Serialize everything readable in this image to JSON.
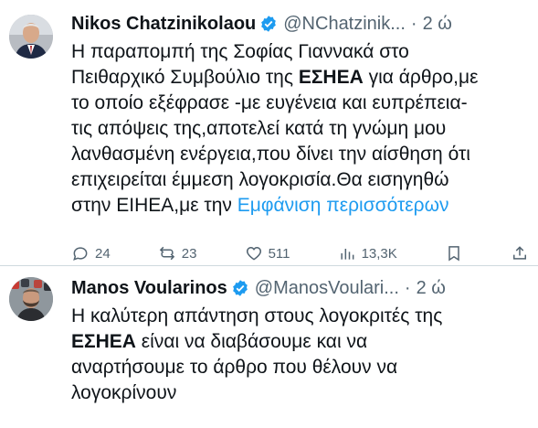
{
  "tweets": [
    {
      "author_name": "Nikos Chatzinikolaou",
      "handle": "@NChatzinik...",
      "separator": "·",
      "time": "2 ώ",
      "lines": [
        [
          {
            "t": "Η παραπομπή της Σοφίας Γιαννακά στο"
          }
        ],
        [
          {
            "t": "Πειθαρχικό Συμβούλιο της "
          },
          {
            "t": "ΕΣΗΕΑ",
            "b": true
          },
          {
            "t": " για άρθρο,με"
          }
        ],
        [
          {
            "t": "το οποίο εξέφρασε -με ευγένεια και ευπρέπεια-"
          }
        ],
        [
          {
            "t": "τις απόψεις της,αποτελεί κατά τη γνώμη μου"
          }
        ],
        [
          {
            "t": "λανθασμένη ενέργεια,που δίνει την αίσθηση ότι"
          }
        ],
        [
          {
            "t": "επιχειρείται έμμεση λογοκρισία.Θα εισηγηθώ"
          }
        ],
        [
          {
            "t": "στην ΕΙΗΕΑ,με την "
          },
          {
            "t": "Εμφάνιση περισσότερων",
            "link": true
          }
        ]
      ],
      "actions": [
        {
          "icon": "reply-icon",
          "count": "24"
        },
        {
          "icon": "retweet-icon",
          "count": "23"
        },
        {
          "icon": "like-icon",
          "count": "511"
        },
        {
          "icon": "views-icon",
          "count": "13,3K"
        },
        {
          "icon": "bookmark-icon",
          "count": ""
        },
        {
          "icon": "share-icon",
          "count": ""
        }
      ]
    },
    {
      "author_name": "Manos Voularinos",
      "handle": "@ManosVoulari...",
      "separator": "·",
      "time": "2 ώ",
      "lines": [
        [
          {
            "t": "Η καλύτερη απάντηση στους λογοκριτές της"
          }
        ],
        [
          {
            "t": "ΕΣΗΕΑ",
            "b": true
          },
          {
            "t": " είναι να διαβάσουμε και να"
          }
        ],
        [
          {
            "t": "αναρτήσουμε το άρθρο που θέλουν να"
          }
        ],
        [
          {
            "t": "λογοκρίνουν"
          }
        ]
      ]
    }
  ],
  "colors": {
    "text": "#0f1419",
    "secondary": "#536471",
    "link": "#1d9bf0",
    "verified": "#1d9bf0",
    "divider": "#cfd9de"
  }
}
